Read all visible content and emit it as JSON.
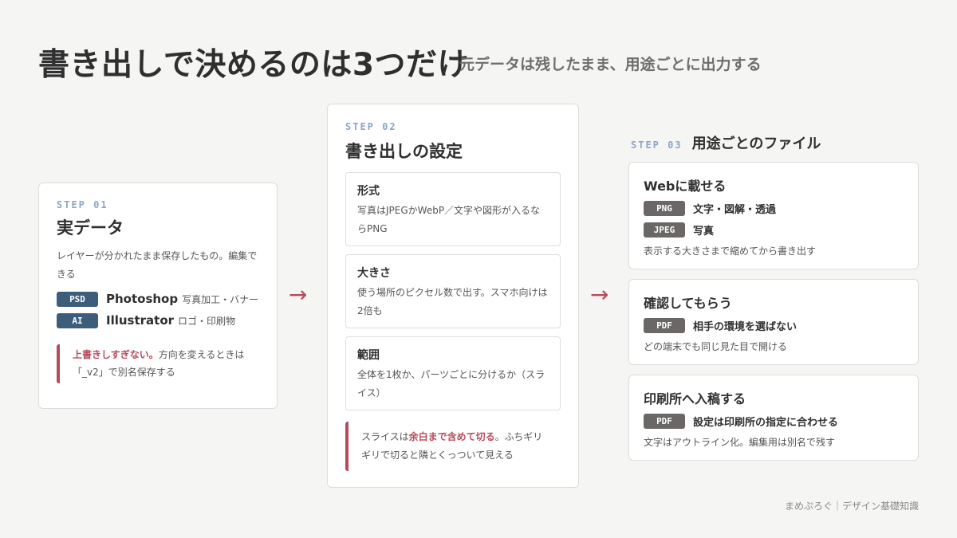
{
  "header": {
    "title": "書き出しで決めるのは3つだけ",
    "subtitle": "元データは残したまま、用途ごとに出力する"
  },
  "step1": {
    "label": "STEP 01",
    "title": "実データ",
    "description": "レイヤーが分かれたまま保存したもの。編集できる",
    "formats": [
      {
        "badge": "PSD",
        "name": "Photoshop",
        "note": "写真加工・バナー"
      },
      {
        "badge": "AI",
        "name": "Illustrator",
        "note": "ロゴ・印刷物"
      }
    ],
    "note_emphasis": "上書きしすぎない。",
    "note_text": "方向を変えるときは「_v2」で別名保存する"
  },
  "arrow": "→",
  "step2": {
    "label": "STEP 02",
    "title": "書き出しの設定",
    "items": [
      {
        "title": "形式",
        "text": "写真はJPEGかWebP／文字や図形が入るならPNG"
      },
      {
        "title": "大きさ",
        "text": "使う場所のピクセル数で出す。スマホ向けは2倍も"
      },
      {
        "title": "範囲",
        "text": "全体を1枚か、パーツごとに分けるか（スライス）"
      }
    ],
    "note_pre": "スライスは",
    "note_emphasis": "余白まで含めて切る",
    "note_post": "。ふちギリギリで切ると隣とくっついて見える"
  },
  "step3": {
    "label": "STEP 03",
    "title": "用途ごとのファイル",
    "uses": [
      {
        "title": "Webに載せる",
        "formats": [
          {
            "badge": "PNG",
            "text": "文字・図解・透過"
          },
          {
            "badge": "JPEG",
            "text": "写真"
          }
        ],
        "note": "表示する大きさまで縮めてから書き出す"
      },
      {
        "title": "確認してもらう",
        "formats": [
          {
            "badge": "PDF",
            "text": "相手の環境を選ばない"
          }
        ],
        "note": "どの端末でも同じ見た目で開ける"
      },
      {
        "title": "印刷所へ入稿する",
        "formats": [
          {
            "badge": "PDF",
            "text": "設定は印刷所の指定に合わせる"
          }
        ],
        "note": "文字はアウトライン化。編集用は別名で残す"
      }
    ]
  },
  "footer": "まめぷろぐ｜デザイン基礎知識",
  "colors": {
    "accent": "#b84a5b",
    "badge_blue": "#3d5e7a",
    "badge_gray": "#6b6767",
    "step_label": "#8ba6c6",
    "background": "#f5f5f3"
  }
}
